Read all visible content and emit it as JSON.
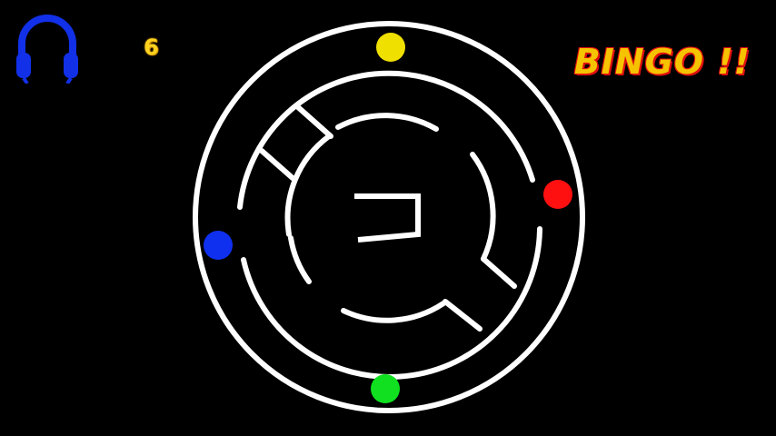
{
  "hud": {
    "score": "6",
    "bingo_text": "BINGO !!",
    "headphones_icon": "headphones-icon"
  },
  "maze": {
    "goal_symbol": "ㅋ",
    "colors": {
      "background": "#000000",
      "walls": "#ffffff",
      "headphones": "#1230e8",
      "score": "#ffd21f",
      "bingo_fill": "#f5c300",
      "bingo_outline": "#e01010"
    },
    "balls": [
      {
        "name": "yellow-ball",
        "color": "#f0e000",
        "position": "top"
      },
      {
        "name": "red-ball",
        "color": "#ff1010",
        "position": "right"
      },
      {
        "name": "green-ball",
        "color": "#10e020",
        "position": "bottom"
      },
      {
        "name": "blue-ball",
        "color": "#1030f0",
        "position": "left"
      }
    ]
  }
}
